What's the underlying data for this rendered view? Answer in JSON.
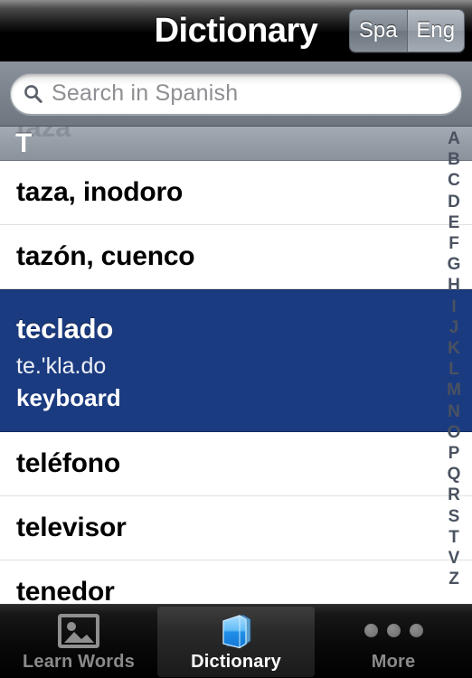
{
  "header": {
    "title": "Dictionary",
    "language_toggle": {
      "options": [
        "Spa",
        "Eng"
      ],
      "selected": "Eng"
    }
  },
  "search": {
    "placeholder": "Search in Spanish",
    "value": "",
    "icon": "search-icon"
  },
  "list": {
    "section_letter": "T",
    "ghost_previous_entry": "taza",
    "rows": [
      {
        "term": "taza, inodoro",
        "selected": false
      },
      {
        "term": "tazón, cuenco",
        "selected": false
      },
      {
        "term": "teclado",
        "phonetic": "te.'kla.do",
        "translation": "keyboard",
        "selected": true
      },
      {
        "term": "teléfono",
        "selected": false
      },
      {
        "term": "televisor",
        "selected": false
      },
      {
        "term": "tenedor",
        "selected": false
      }
    ]
  },
  "index_bar": {
    "letters": [
      "A",
      "B",
      "C",
      "D",
      "E",
      "F",
      "G",
      "H",
      "I",
      "J",
      "K",
      "L",
      "M",
      "N",
      "O",
      "P",
      "Q",
      "R",
      "S",
      "T",
      "V",
      "Z"
    ]
  },
  "tabbar": {
    "tabs": [
      {
        "label": "Learn Words",
        "icon": "photo-icon",
        "active": false
      },
      {
        "label": "Dictionary",
        "icon": "book-icon",
        "active": true
      },
      {
        "label": "More",
        "icon": "ellipsis-icon",
        "active": false
      }
    ]
  },
  "colors": {
    "selection_blue": "#1b3b80",
    "book_blue": "#3ea8f0",
    "chrome_gray": "#7b838d"
  }
}
